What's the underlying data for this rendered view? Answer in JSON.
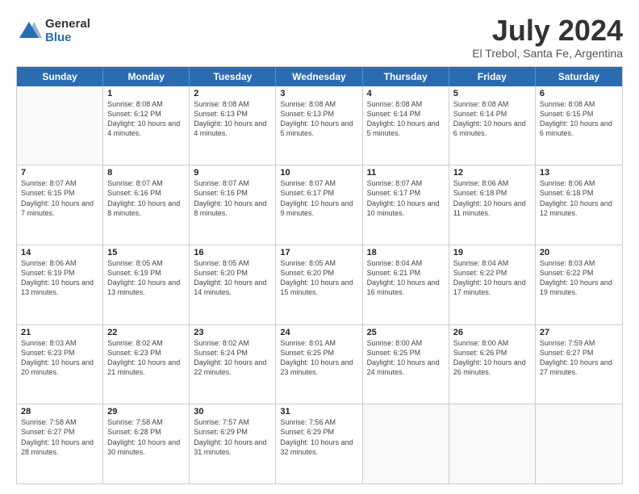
{
  "logo": {
    "general": "General",
    "blue": "Blue"
  },
  "title": "July 2024",
  "subtitle": "El Trebol, Santa Fe, Argentina",
  "headers": [
    "Sunday",
    "Monday",
    "Tuesday",
    "Wednesday",
    "Thursday",
    "Friday",
    "Saturday"
  ],
  "weeks": [
    [
      {
        "day": "",
        "sunrise": "",
        "sunset": "",
        "daylight": ""
      },
      {
        "day": "1",
        "sunrise": "Sunrise: 8:08 AM",
        "sunset": "Sunset: 6:12 PM",
        "daylight": "Daylight: 10 hours and 4 minutes."
      },
      {
        "day": "2",
        "sunrise": "Sunrise: 8:08 AM",
        "sunset": "Sunset: 6:13 PM",
        "daylight": "Daylight: 10 hours and 4 minutes."
      },
      {
        "day": "3",
        "sunrise": "Sunrise: 8:08 AM",
        "sunset": "Sunset: 6:13 PM",
        "daylight": "Daylight: 10 hours and 5 minutes."
      },
      {
        "day": "4",
        "sunrise": "Sunrise: 8:08 AM",
        "sunset": "Sunset: 6:14 PM",
        "daylight": "Daylight: 10 hours and 5 minutes."
      },
      {
        "day": "5",
        "sunrise": "Sunrise: 8:08 AM",
        "sunset": "Sunset: 6:14 PM",
        "daylight": "Daylight: 10 hours and 6 minutes."
      },
      {
        "day": "6",
        "sunrise": "Sunrise: 8:08 AM",
        "sunset": "Sunset: 6:15 PM",
        "daylight": "Daylight: 10 hours and 6 minutes."
      }
    ],
    [
      {
        "day": "7",
        "sunrise": "Sunrise: 8:07 AM",
        "sunset": "Sunset: 6:15 PM",
        "daylight": "Daylight: 10 hours and 7 minutes."
      },
      {
        "day": "8",
        "sunrise": "Sunrise: 8:07 AM",
        "sunset": "Sunset: 6:16 PM",
        "daylight": "Daylight: 10 hours and 8 minutes."
      },
      {
        "day": "9",
        "sunrise": "Sunrise: 8:07 AM",
        "sunset": "Sunset: 6:16 PM",
        "daylight": "Daylight: 10 hours and 8 minutes."
      },
      {
        "day": "10",
        "sunrise": "Sunrise: 8:07 AM",
        "sunset": "Sunset: 6:17 PM",
        "daylight": "Daylight: 10 hours and 9 minutes."
      },
      {
        "day": "11",
        "sunrise": "Sunrise: 8:07 AM",
        "sunset": "Sunset: 6:17 PM",
        "daylight": "Daylight: 10 hours and 10 minutes."
      },
      {
        "day": "12",
        "sunrise": "Sunrise: 8:06 AM",
        "sunset": "Sunset: 6:18 PM",
        "daylight": "Daylight: 10 hours and 11 minutes."
      },
      {
        "day": "13",
        "sunrise": "Sunrise: 8:06 AM",
        "sunset": "Sunset: 6:18 PM",
        "daylight": "Daylight: 10 hours and 12 minutes."
      }
    ],
    [
      {
        "day": "14",
        "sunrise": "Sunrise: 8:06 AM",
        "sunset": "Sunset: 6:19 PM",
        "daylight": "Daylight: 10 hours and 13 minutes."
      },
      {
        "day": "15",
        "sunrise": "Sunrise: 8:05 AM",
        "sunset": "Sunset: 6:19 PM",
        "daylight": "Daylight: 10 hours and 13 minutes."
      },
      {
        "day": "16",
        "sunrise": "Sunrise: 8:05 AM",
        "sunset": "Sunset: 6:20 PM",
        "daylight": "Daylight: 10 hours and 14 minutes."
      },
      {
        "day": "17",
        "sunrise": "Sunrise: 8:05 AM",
        "sunset": "Sunset: 6:20 PM",
        "daylight": "Daylight: 10 hours and 15 minutes."
      },
      {
        "day": "18",
        "sunrise": "Sunrise: 8:04 AM",
        "sunset": "Sunset: 6:21 PM",
        "daylight": "Daylight: 10 hours and 16 minutes."
      },
      {
        "day": "19",
        "sunrise": "Sunrise: 8:04 AM",
        "sunset": "Sunset: 6:22 PM",
        "daylight": "Daylight: 10 hours and 17 minutes."
      },
      {
        "day": "20",
        "sunrise": "Sunrise: 8:03 AM",
        "sunset": "Sunset: 6:22 PM",
        "daylight": "Daylight: 10 hours and 19 minutes."
      }
    ],
    [
      {
        "day": "21",
        "sunrise": "Sunrise: 8:03 AM",
        "sunset": "Sunset: 6:23 PM",
        "daylight": "Daylight: 10 hours and 20 minutes."
      },
      {
        "day": "22",
        "sunrise": "Sunrise: 8:02 AM",
        "sunset": "Sunset: 6:23 PM",
        "daylight": "Daylight: 10 hours and 21 minutes."
      },
      {
        "day": "23",
        "sunrise": "Sunrise: 8:02 AM",
        "sunset": "Sunset: 6:24 PM",
        "daylight": "Daylight: 10 hours and 22 minutes."
      },
      {
        "day": "24",
        "sunrise": "Sunrise: 8:01 AM",
        "sunset": "Sunset: 6:25 PM",
        "daylight": "Daylight: 10 hours and 23 minutes."
      },
      {
        "day": "25",
        "sunrise": "Sunrise: 8:00 AM",
        "sunset": "Sunset: 6:25 PM",
        "daylight": "Daylight: 10 hours and 24 minutes."
      },
      {
        "day": "26",
        "sunrise": "Sunrise: 8:00 AM",
        "sunset": "Sunset: 6:26 PM",
        "daylight": "Daylight: 10 hours and 26 minutes."
      },
      {
        "day": "27",
        "sunrise": "Sunrise: 7:59 AM",
        "sunset": "Sunset: 6:27 PM",
        "daylight": "Daylight: 10 hours and 27 minutes."
      }
    ],
    [
      {
        "day": "28",
        "sunrise": "Sunrise: 7:58 AM",
        "sunset": "Sunset: 6:27 PM",
        "daylight": "Daylight: 10 hours and 28 minutes."
      },
      {
        "day": "29",
        "sunrise": "Sunrise: 7:58 AM",
        "sunset": "Sunset: 6:28 PM",
        "daylight": "Daylight: 10 hours and 30 minutes."
      },
      {
        "day": "30",
        "sunrise": "Sunrise: 7:57 AM",
        "sunset": "Sunset: 6:29 PM",
        "daylight": "Daylight: 10 hours and 31 minutes."
      },
      {
        "day": "31",
        "sunrise": "Sunrise: 7:56 AM",
        "sunset": "Sunset: 6:29 PM",
        "daylight": "Daylight: 10 hours and 32 minutes."
      },
      {
        "day": "",
        "sunrise": "",
        "sunset": "",
        "daylight": ""
      },
      {
        "day": "",
        "sunrise": "",
        "sunset": "",
        "daylight": ""
      },
      {
        "day": "",
        "sunrise": "",
        "sunset": "",
        "daylight": ""
      }
    ]
  ]
}
